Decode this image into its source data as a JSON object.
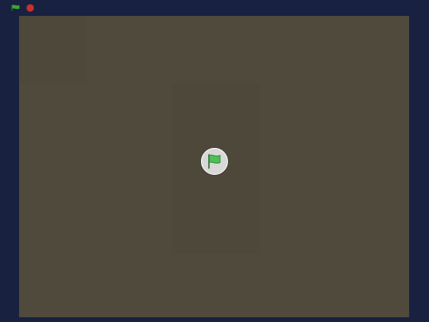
{
  "controls": {
    "green_flag_icon": "green-flag-icon",
    "stop_icon": "stop-sign-icon",
    "flag_color": "#3da33d",
    "stop_color": "#c9302c"
  },
  "stage": {
    "background_color": "#4f4a3c",
    "start_overlay_icon": "green-flag-icon",
    "overlay_flag_color": "#4cbf56"
  }
}
